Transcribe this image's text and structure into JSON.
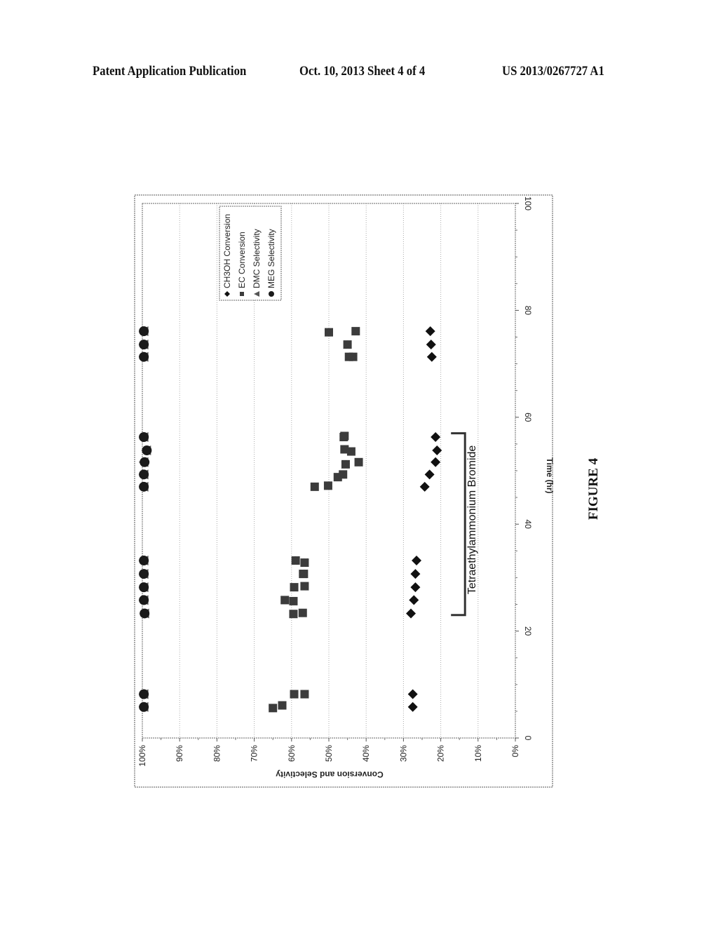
{
  "header": {
    "left": "Patent Application Publication",
    "middle": "Oct. 10, 2013   Sheet 4 of 4",
    "right": "US 2013/0267727 A1"
  },
  "figure_label": "FIGURE 4",
  "chart_data": {
    "type": "scatter",
    "orientation": "rotated 90 degrees clockwise on the page",
    "title": "",
    "xlabel": "Time (hr)",
    "ylabel": "Conversion and Selectivity",
    "xlim": [
      0,
      100
    ],
    "ylim": [
      0,
      100
    ],
    "x_ticks": [
      0,
      20,
      40,
      60,
      80,
      100
    ],
    "x_tick_labels": [
      "0",
      "20",
      "40",
      "60",
      "80",
      "100"
    ],
    "y_ticks": [
      0,
      10,
      20,
      30,
      40,
      50,
      60,
      70,
      80,
      90,
      100
    ],
    "y_tick_labels": [
      "0%",
      "10%",
      "20%",
      "30%",
      "40%",
      "50%",
      "60%",
      "70%",
      "80%",
      "90%",
      "100%"
    ],
    "grid": "horizontal dotted gridlines at each 10%",
    "legend_position": "top-right",
    "annotation": {
      "text": "Tetraethylammonium Bromide",
      "bracket_from_hr": 23,
      "bracket_to_hr": 57,
      "level_pct": 15
    },
    "series": [
      {
        "name": "CH3OH Conversion",
        "marker": "diamond",
        "points": [
          [
            5.8,
            27.5
          ],
          [
            8.2,
            27.5
          ],
          [
            23.3,
            28.0
          ],
          [
            25.8,
            27.2
          ],
          [
            28.2,
            26.8
          ],
          [
            30.7,
            26.8
          ],
          [
            33.2,
            26.5
          ],
          [
            47.0,
            24.3
          ],
          [
            49.3,
            23.0
          ],
          [
            51.6,
            21.4
          ],
          [
            53.8,
            21.0
          ],
          [
            56.3,
            21.4
          ],
          [
            71.3,
            22.4
          ],
          [
            73.6,
            22.6
          ],
          [
            76.1,
            22.8
          ]
        ]
      },
      {
        "name": "EC Conversion",
        "marker": "square",
        "points": [
          [
            5.6,
            65.0
          ],
          [
            6.1,
            62.5
          ],
          [
            8.2,
            59.3
          ],
          [
            8.2,
            56.5
          ],
          [
            23.2,
            59.5
          ],
          [
            23.4,
            57.0
          ],
          [
            25.6,
            59.5
          ],
          [
            25.8,
            61.8
          ],
          [
            28.2,
            59.3
          ],
          [
            28.4,
            56.5
          ],
          [
            30.7,
            56.7
          ],
          [
            30.7,
            56.9
          ],
          [
            32.8,
            56.5
          ],
          [
            33.2,
            58.9
          ],
          [
            47.0,
            53.8
          ],
          [
            47.2,
            50.2
          ],
          [
            48.8,
            47.6
          ],
          [
            49.3,
            46.2
          ],
          [
            51.2,
            45.5
          ],
          [
            51.6,
            42.0
          ],
          [
            53.6,
            44.0
          ],
          [
            54.0,
            45.8
          ],
          [
            56.3,
            46.0
          ],
          [
            56.5,
            45.8
          ],
          [
            71.3,
            44.6
          ],
          [
            71.3,
            43.5
          ],
          [
            73.6,
            45.0
          ],
          [
            75.9,
            50.0
          ],
          [
            76.1,
            42.8
          ]
        ]
      },
      {
        "name": "DMC Selectivity",
        "marker": "triangle",
        "points": [
          [
            5.8,
            99.7
          ],
          [
            8.2,
            99.7
          ],
          [
            23.3,
            99.5
          ],
          [
            25.8,
            99.7
          ],
          [
            28.2,
            99.7
          ],
          [
            30.7,
            99.7
          ],
          [
            33.2,
            99.7
          ],
          [
            47.0,
            99.7
          ],
          [
            49.3,
            99.7
          ],
          [
            51.6,
            99.7
          ],
          [
            53.8,
            99.0
          ],
          [
            56.3,
            99.7
          ],
          [
            71.3,
            99.7
          ],
          [
            73.6,
            99.7
          ],
          [
            76.1,
            99.7
          ]
        ]
      },
      {
        "name": "MEG Selectivity",
        "marker": "circle",
        "points": [
          [
            5.8,
            99.6
          ],
          [
            8.2,
            99.6
          ],
          [
            23.3,
            99.4
          ],
          [
            25.8,
            99.6
          ],
          [
            28.2,
            99.6
          ],
          [
            30.7,
            99.6
          ],
          [
            33.2,
            99.6
          ],
          [
            47.0,
            99.6
          ],
          [
            49.3,
            99.6
          ],
          [
            51.6,
            99.4
          ],
          [
            53.8,
            98.8
          ],
          [
            56.3,
            99.6
          ],
          [
            71.3,
            99.6
          ],
          [
            73.6,
            99.6
          ],
          [
            76.1,
            99.6
          ]
        ]
      }
    ]
  }
}
